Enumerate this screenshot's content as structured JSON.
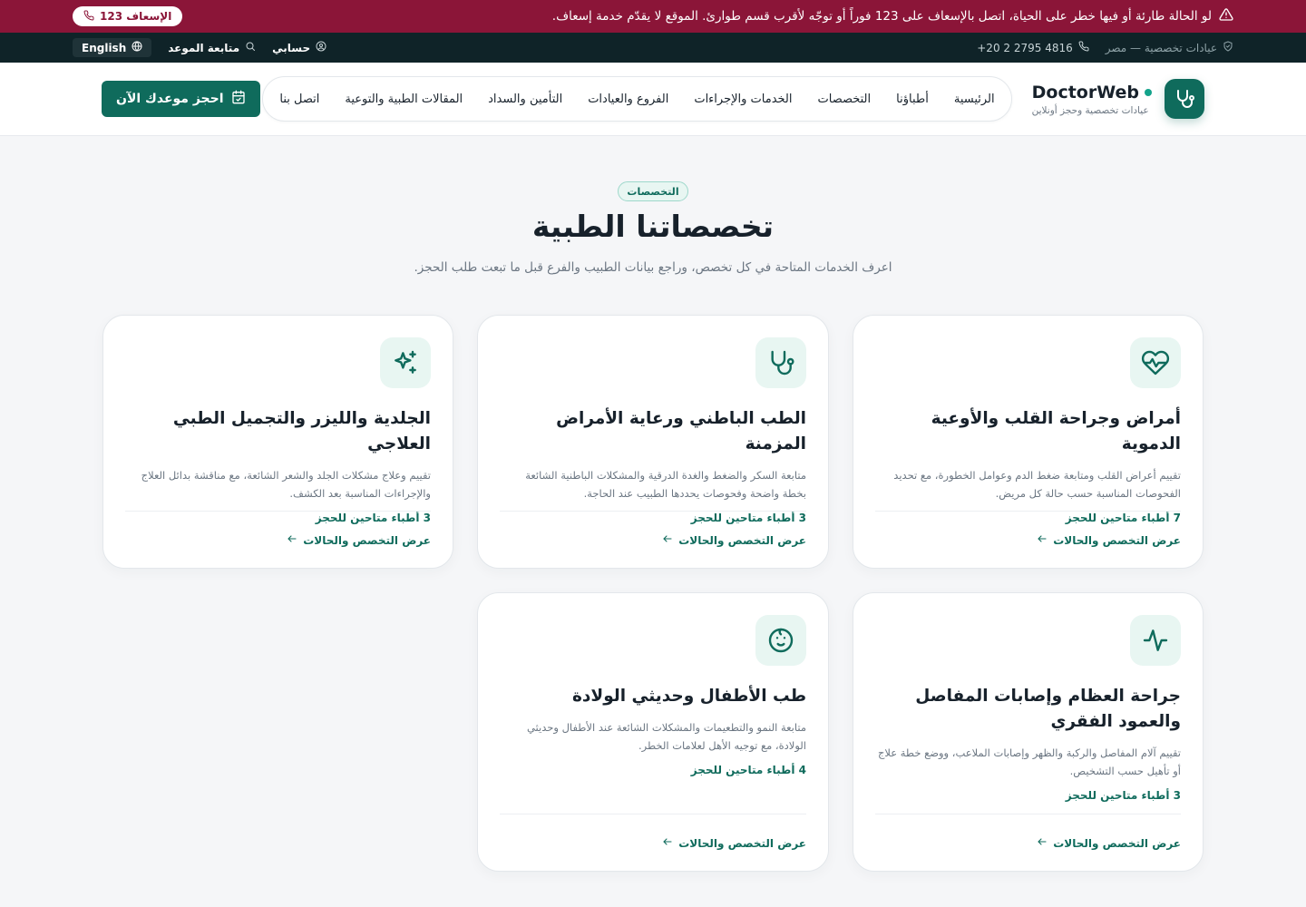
{
  "emergency": {
    "message": "لو الحالة طارئة أو فيها خطر على الحياة، اتصل بالإسعاف على 123 فوراً أو توجّه لأقرب قسم طوارئ. الموقع لا يقدّم خدمة إسعاف.",
    "button_label": "الإسعاف 123"
  },
  "utility": {
    "clinic_label": "عيادات تخصصية — مصر",
    "phone": "+20 2 2795 4816",
    "account_label": "حسابي",
    "track_label": "متابعة الموعد",
    "language_label": "English"
  },
  "header": {
    "brand_name": "DoctorWeb",
    "brand_tagline": "عيادات تخصصية وحجز أونلاين",
    "nav": [
      {
        "label": "الرئيسية"
      },
      {
        "label": "أطباؤنا"
      },
      {
        "label": "التخصصات"
      },
      {
        "label": "الخدمات والإجراءات"
      },
      {
        "label": "الفروع والعيادات"
      },
      {
        "label": "التأمين والسداد"
      },
      {
        "label": "المقالات الطبية والتوعية"
      },
      {
        "label": "اتصل بنا"
      }
    ],
    "book_label": "احجز موعدك الآن"
  },
  "section": {
    "tag": "التخصصات",
    "title": "تخصصاتنا الطبية",
    "subtitle": "اعرف الخدمات المتاحة في كل تخصص، وراجع بيانات الطبيب والفرع قبل ما تبعت طلب الحجز."
  },
  "cards": [
    {
      "icon": "heart-pulse-icon",
      "title": "أمراض وجراحة القلب والأوعية الدموية",
      "description": "تقييم أعراض القلب ومتابعة ضغط الدم وعوامل الخطورة، مع تحديد الفحوصات المناسبة حسب حالة كل مريض.",
      "doctors": "7 أطباء متاحين للحجز",
      "link": "عرض التخصص والحالات"
    },
    {
      "icon": "stethoscope-icon",
      "title": "الطب الباطني ورعاية الأمراض المزمنة",
      "description": "متابعة السكر والضغط والغدة الدرقية والمشكلات الباطنية الشائعة بخطة واضحة وفحوصات يحددها الطبيب عند الحاجة.",
      "doctors": "3 أطباء متاحين للحجز",
      "link": "عرض التخصص والحالات"
    },
    {
      "icon": "sparkles-icon",
      "title": "الجلدية والليزر والتجميل الطبي العلاجي",
      "description": "تقييم وعلاج مشكلات الجلد والشعر الشائعة، مع مناقشة بدائل العلاج والإجراءات المناسبة بعد الكشف.",
      "doctors": "3 أطباء متاحين للحجز",
      "link": "عرض التخصص والحالات"
    },
    {
      "icon": "activity-icon",
      "title": "جراحة العظام وإصابات المفاصل والعمود الفقري",
      "description": "تقييم آلام المفاصل والركبة والظهر وإصابات الملاعب، ووضع خطة علاج أو تأهيل حسب التشخيص.",
      "doctors": "3 أطباء متاحين للحجز",
      "link": "عرض التخصص والحالات"
    },
    {
      "icon": "baby-icon",
      "title": "طب الأطفال وحديثي الولادة",
      "description": "متابعة النمو والتطعيمات والمشكلات الشائعة عند الأطفال وحديثي الولادة، مع توجيه الأهل لعلامات الخطر.",
      "doctors": "4 أطباء متاحين للحجز",
      "link": "عرض التخصص والحالات"
    }
  ],
  "colors": {
    "emergency": "#8b1538",
    "utility_bar": "#0f2328",
    "accent": "#0f6b5c",
    "accent_light": "#e8f6f2"
  }
}
